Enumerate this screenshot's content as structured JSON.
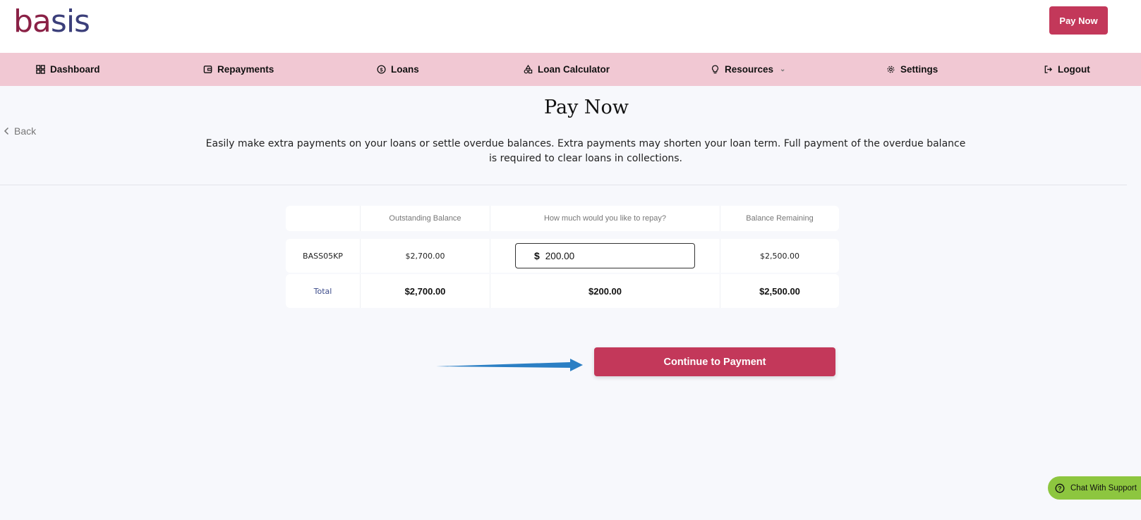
{
  "brand": {
    "logo_part1": "ba",
    "logo_part2": "sis"
  },
  "header": {
    "pay_now_label": "Pay Now"
  },
  "nav": {
    "items": [
      {
        "label": "Dashboard",
        "icon": "dashboard-icon"
      },
      {
        "label": "Repayments",
        "icon": "wallet-icon"
      },
      {
        "label": "Loans",
        "icon": "dollar-coin-icon"
      },
      {
        "label": "Loan Calculator",
        "icon": "shapes-icon"
      },
      {
        "label": "Resources",
        "icon": "lightbulb-icon"
      },
      {
        "label": "Settings",
        "icon": "gear-icon"
      },
      {
        "label": "Logout",
        "icon": "logout-icon"
      }
    ]
  },
  "page": {
    "back_label": "Back",
    "title": "Pay Now",
    "intro": "Easily make extra payments on your loans or settle overdue balances. Extra payments may shorten your loan term. Full payment of the overdue balance is required to clear loans in collections."
  },
  "table": {
    "headers": [
      "",
      "Outstanding Balance",
      "How much would you like to repay?",
      "Balance Remaining"
    ],
    "row": {
      "loan_id": "BASS05KP",
      "outstanding": "$2,700.00",
      "currency_symbol": "$",
      "repay_value": "200.00",
      "remaining": "$2,500.00"
    },
    "total": {
      "label": "Total",
      "outstanding": "$2,700.00",
      "repay": "$200.00",
      "remaining": "$2,500.00"
    }
  },
  "actions": {
    "continue_label": "Continue to Payment"
  },
  "support": {
    "chat_label": "Chat With Support"
  },
  "colors": {
    "primary": "#c3385a",
    "nav_bg": "#f1c8d3",
    "chat_bg": "#8dc63f",
    "arrow": "#2b7fc4"
  }
}
